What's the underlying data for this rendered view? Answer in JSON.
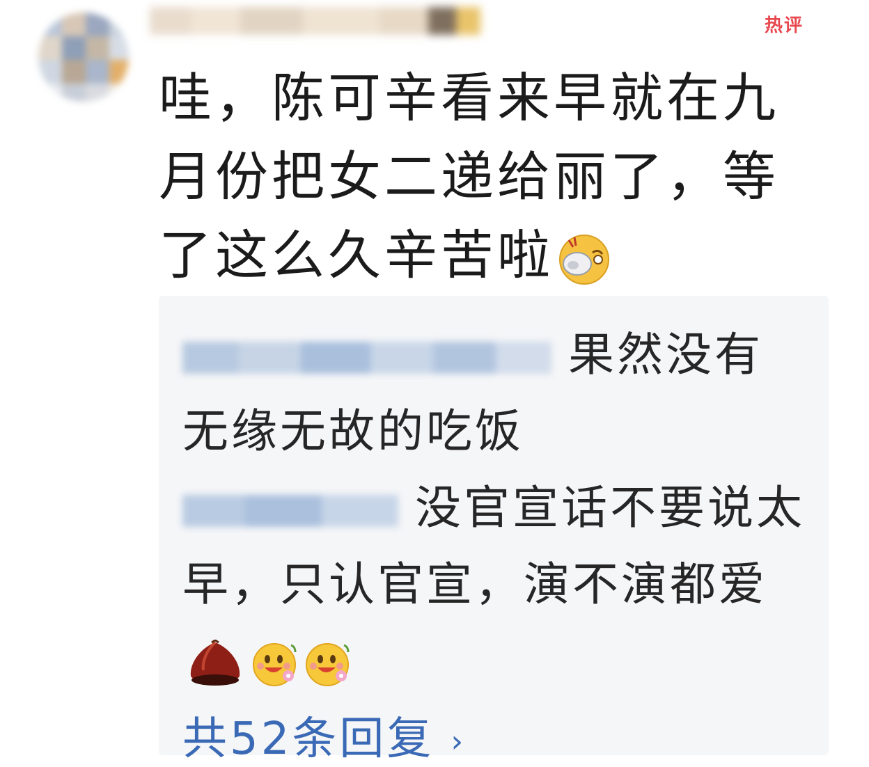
{
  "header": {
    "hot_badge": "热评"
  },
  "comment": {
    "text": "哇，陈可辛看来早就在九月份把女二递给丽了，等了这么久辛苦啦",
    "emoji": "doge-icon"
  },
  "replies": [
    {
      "text": "果然没有无缘无故的吃饭",
      "emojis": []
    },
    {
      "text": "没官宣话不要说太早，只认官宣，演不演都爱",
      "emojis": [
        "chestnut-icon",
        "smiling-flower-icon",
        "smiling-flower-icon"
      ]
    }
  ],
  "footer": {
    "view_replies_label": "共52条回复",
    "chevron": "›"
  },
  "colors": {
    "hot_badge": "#e8484f",
    "link": "#3a69b5",
    "reply_bg": "#f5f6f8",
    "text": "#1b1b1b"
  }
}
